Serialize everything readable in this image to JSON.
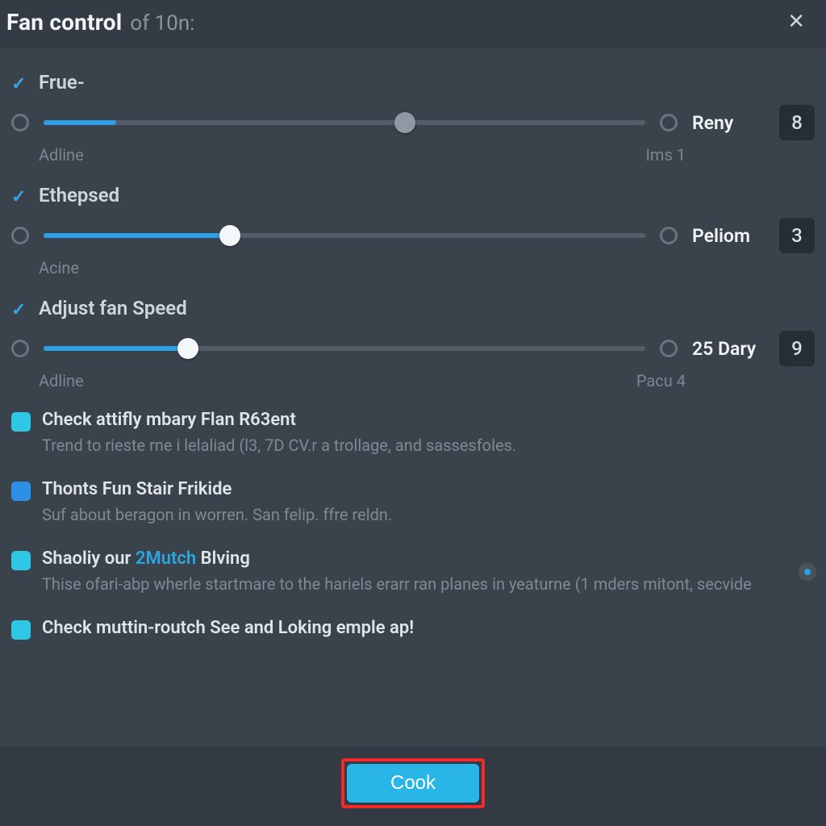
{
  "title": {
    "main": "Fan control",
    "sub": "of 10n:"
  },
  "sliders": [
    {
      "label": "Frue-",
      "left_sub": "Adline",
      "right_sub": "Ims  1",
      "right_label": "Reny",
      "value": "8",
      "fill_pct": 12,
      "thumb_pct": 60,
      "thumb_color": "grey"
    },
    {
      "label": "Ethepsed",
      "left_sub": "Acine",
      "right_sub": "",
      "right_label": "Peliom",
      "value": "3",
      "fill_pct": 31,
      "thumb_pct": 31,
      "thumb_color": "white"
    },
    {
      "label": "Adjust fan Speed",
      "left_sub": "Adline",
      "right_sub": "Pacu  4",
      "right_label": "25 Dary",
      "value": "9",
      "fill_pct": 24,
      "thumb_pct": 24,
      "thumb_color": "white"
    }
  ],
  "options": [
    {
      "box": "cyan",
      "title": "Check attifly mbary Flan R63ent",
      "desc": "Trend to rieste rne i lelaliad (l3, 7D CV.r a trollage, and sassesfoles.",
      "side_radio": false
    },
    {
      "box": "blue",
      "title": "Thonts Fun Stair Frikide",
      "desc": "Suf about beragon in worren. San felip. ffre reldn.",
      "side_radio": false
    },
    {
      "box": "cyan",
      "title_pre": "Shaoliy our ",
      "title_hl": "2Mutch",
      "title_post": " Blving",
      "desc": "Thise ofari-abp wherle startmare to the hariels erarr ran planes in yeaturne (1 mders mitont, secvide",
      "side_radio": true
    },
    {
      "box": "cyan",
      "title": "Check muttin-routch See and Loking emple ap!",
      "desc": "",
      "side_radio": false
    }
  ],
  "footer": {
    "button": "Cook"
  }
}
